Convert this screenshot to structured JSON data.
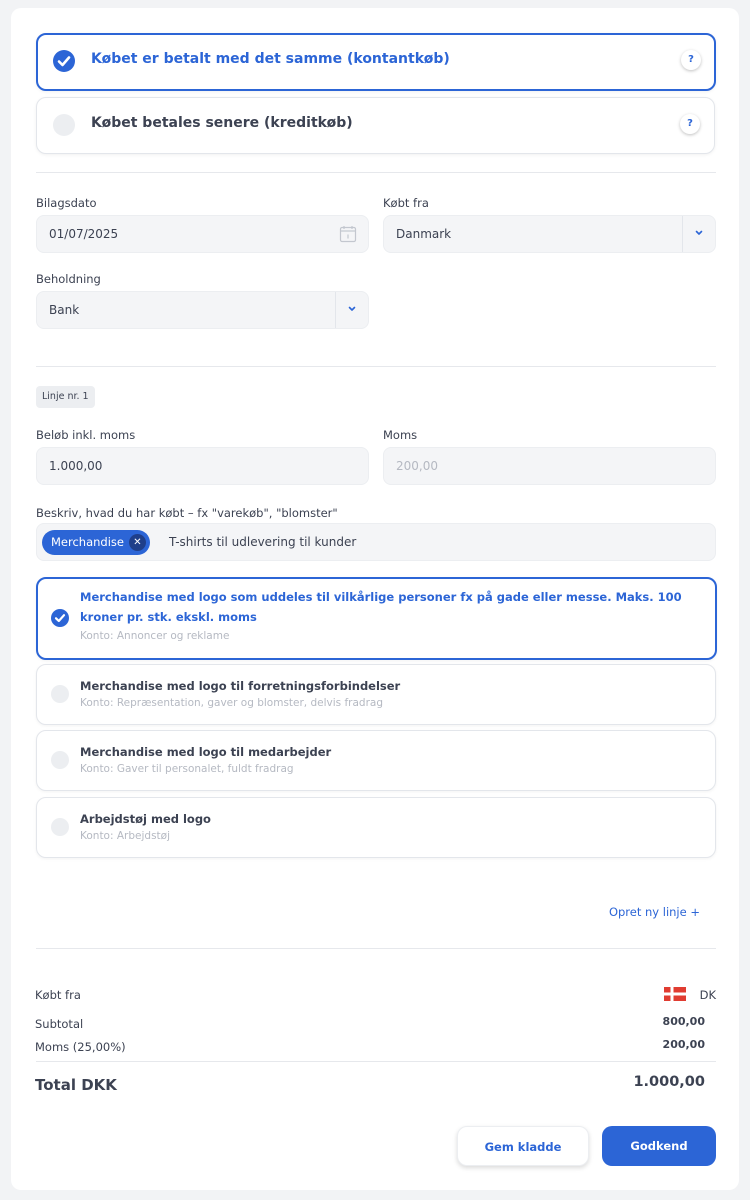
{
  "payment": {
    "options": [
      {
        "label": "Købet er betalt med det samme (kontantkøb)",
        "selected": true
      },
      {
        "label": "Købet betales senere (kreditkøb)",
        "selected": false
      }
    ],
    "help_glyph": "?"
  },
  "form": {
    "bilagsdato": {
      "label": "Bilagsdato",
      "value": "01/07/2025"
    },
    "koebt_fra": {
      "label": "Købt fra",
      "value": "Danmark"
    },
    "beholdning": {
      "label": "Beholdning",
      "value": "Bank"
    }
  },
  "line": {
    "badge": "Linje nr. 1",
    "amount": {
      "label": "Beløb inkl. moms",
      "value": "1.000,00"
    },
    "vat": {
      "label": "Moms",
      "value": "200,00"
    },
    "describe": {
      "label": "Beskriv, hvad du har købt – fx \"varekøb\", \"blomster\"",
      "chip": "Merchandise",
      "text": "T-shirts til udlevering til kunder"
    }
  },
  "accounts": [
    {
      "title": "Merchandise med logo som uddeles til vilkårlige personer fx på gade eller messe. Maks. 100 kroner pr. stk. ekskl. moms",
      "sub": "Konto: Annoncer og reklame",
      "selected": true
    },
    {
      "title": "Merchandise med logo til forretningsforbindelser",
      "sub": "Konto: Repræsentation, gaver og blomster, delvis fradrag",
      "selected": false
    },
    {
      "title": "Merchandise med logo til medarbejder",
      "sub": "Konto: Gaver til personalet, fuldt fradrag",
      "selected": false
    },
    {
      "title": "Arbejdstøj med logo",
      "sub": "Konto: Arbejdstøj",
      "selected": false
    }
  ],
  "add_line": "Opret ny linje +",
  "summary": {
    "koebt_fra_label": "Købt fra",
    "country_code": "DK",
    "subtotal_label": "Subtotal",
    "subtotal": "800,00",
    "moms_label": "Moms (25,00%)",
    "moms": "200,00",
    "total_label": "Total DKK",
    "total": "1.000,00"
  },
  "buttons": {
    "draft": "Gem kladde",
    "approve": "Godkend"
  },
  "colors": {
    "accent": "#2c65d6",
    "flag_red": "#e03c31"
  },
  "icons": {
    "check": "check-icon",
    "calendar": "calendar-icon",
    "chevron": "chevron-down-icon",
    "close": "close-icon",
    "flag": "denmark-flag-icon"
  }
}
